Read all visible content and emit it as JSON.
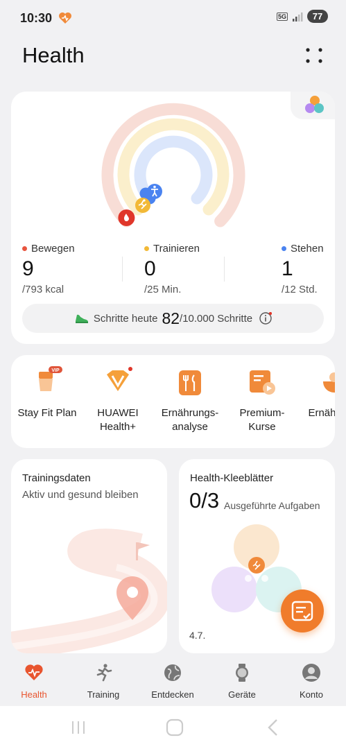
{
  "status": {
    "time": "10:30",
    "network": "5G",
    "battery": "77"
  },
  "app": {
    "title": "Health"
  },
  "activity": {
    "stats": [
      {
        "label": "Bewegen",
        "value": "9",
        "goal": "/793 kcal",
        "color": "#e8553f"
      },
      {
        "label": "Trainieren",
        "value": "0",
        "goal": "/25 Min.",
        "color": "#f2b937"
      },
      {
        "label": "Stehen",
        "value": "1",
        "goal": "/12 Std.",
        "color": "#4a83f0"
      }
    ],
    "steps": {
      "label": "Schritte heute",
      "value": "82",
      "goal": "/10.000 Schritte"
    }
  },
  "services": [
    {
      "label": "Stay Fit Plan",
      "badge": "VIP"
    },
    {
      "label": "HUAWEI Health+"
    },
    {
      "label": "Ernährungs-analyse"
    },
    {
      "label": "Premium-Kurse"
    },
    {
      "label": "Ernähr prot"
    }
  ],
  "training_card": {
    "title": "Trainingsdaten",
    "subtitle": "Aktiv und gesund bleiben"
  },
  "clover_card": {
    "title": "Health-Kleeblätter",
    "count": "0/3",
    "tasks": "Ausgeführte Aufgaben",
    "date": "4.7."
  },
  "nav": [
    {
      "label": "Health",
      "icon": "heart-pulse-icon",
      "active": true
    },
    {
      "label": "Training",
      "icon": "running-icon"
    },
    {
      "label": "Entdecken",
      "icon": "globe-icon"
    },
    {
      "label": "Geräte",
      "icon": "watch-icon"
    },
    {
      "label": "Konto",
      "icon": "person-icon"
    }
  ],
  "colors": {
    "accent": "#e8552f",
    "move": "#e8553f",
    "exercise": "#f2b937",
    "stand": "#4a83f0",
    "fab": "#f07c2b"
  }
}
